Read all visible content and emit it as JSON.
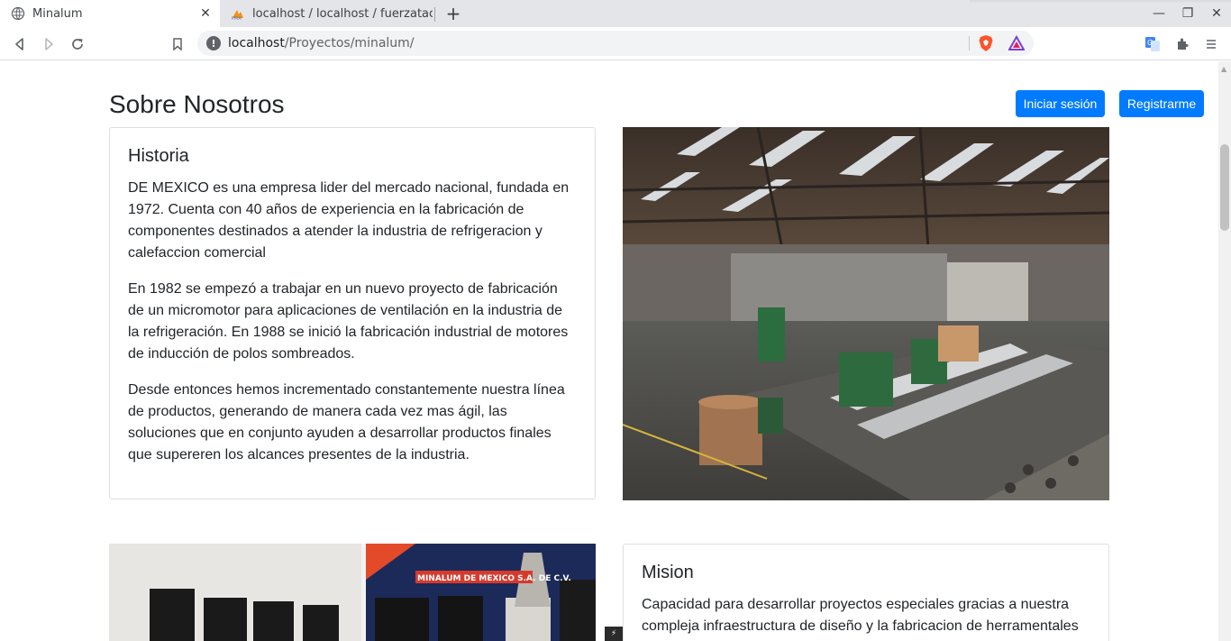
{
  "browser": {
    "tabs": [
      {
        "title": "Minalum",
        "active": true
      },
      {
        "title": "localhost / localhost / fuerzatac",
        "active": false
      }
    ],
    "address": {
      "host": "localhost",
      "path": "/Proyectos/minalum/"
    }
  },
  "page": {
    "section_title": "Sobre Nosotros",
    "buttons": {
      "login": "Iniciar sesión",
      "register": "Registrarme"
    },
    "historia": {
      "title": "Historia",
      "paragraphs": [
        "DE MEXICO es una empresa lider del mercado nacional, fundada en 1972. Cuenta con 40 años de experiencia en la fabricación de componentes destinados a atender la industria de refrigeracion y calefaccion comercial",
        "En 1982 se empezó a trabajar en un nuevo proyecto de fabricación de un micromotor para aplicaciones de ventilación en la industria de la refrigeración. En 1988 se inició la fabricación industrial de motores de inducción de polos sombreados.",
        "Desde entonces hemos incrementado constantemente nuestra línea de productos, generando de manera cada vez mas ágil, las soluciones que en conjunto ayuden a desarrollar productos finales que supereren los alcances presentes de la industria."
      ]
    },
    "mision": {
      "title": "Mision",
      "paragraphs": [
        "Capacidad para desarrollar proyectos especiales gracias a nuestra compleja infraestructura de diseño y la fabricacion de herramentales"
      ]
    },
    "expo_banner_text": "MINALUM DE MEXICO S.A. DE C.V."
  },
  "colors": {
    "primary": "#007bff",
    "tabbar": "#e3e5e8"
  }
}
